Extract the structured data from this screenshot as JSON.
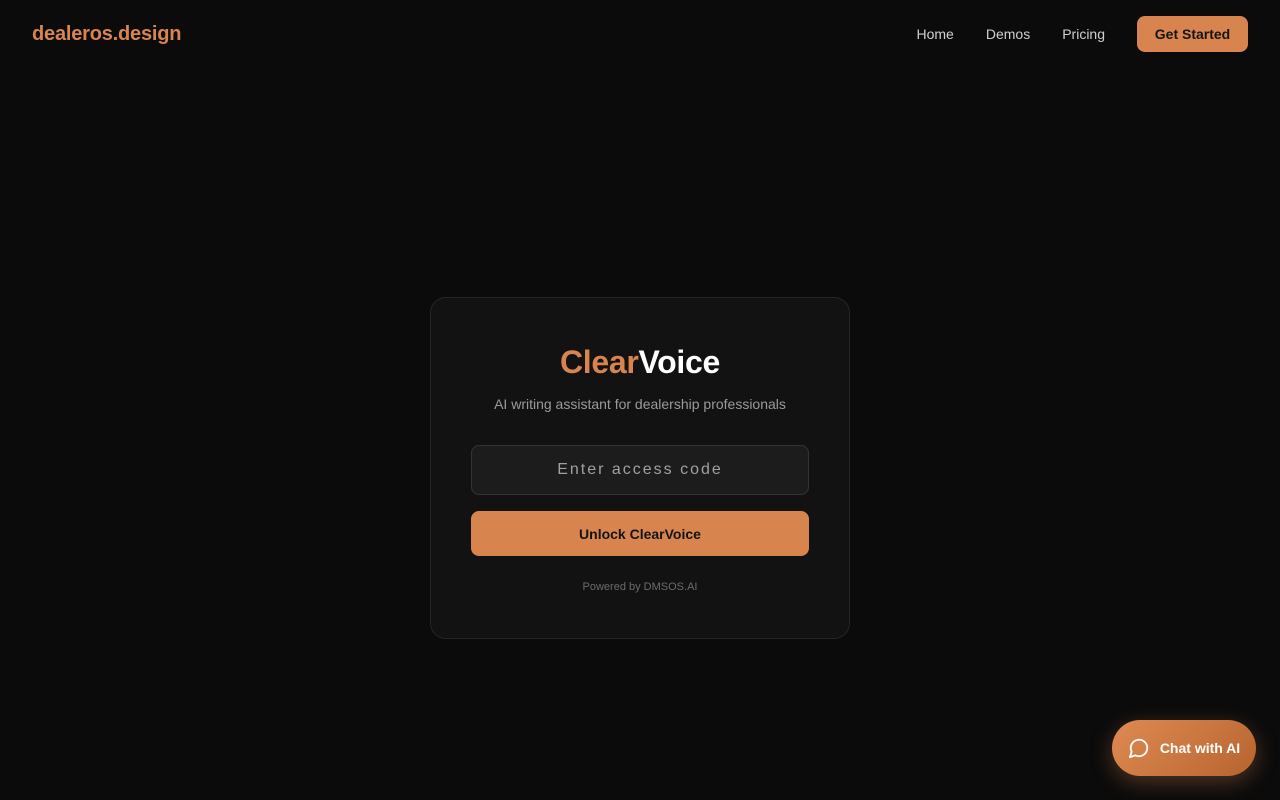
{
  "header": {
    "brand": "dealeros.design",
    "nav": [
      "Home",
      "Demos",
      "Pricing"
    ],
    "cta_label": "Get Started"
  },
  "card": {
    "title_accent": "Clear",
    "title_rest": "Voice",
    "subtitle": "AI writing assistant for dealership professionals",
    "input_placeholder": "Enter access code",
    "input_value": "",
    "button_label": "Unlock ClearVoice",
    "footer": "Powered by DMSOS.AI"
  },
  "chat": {
    "label": "Chat with AI",
    "icon": "chat-bubble-icon"
  },
  "colors": {
    "accent": "#d8844f",
    "background": "#0b0b0b",
    "card": "#121212"
  }
}
